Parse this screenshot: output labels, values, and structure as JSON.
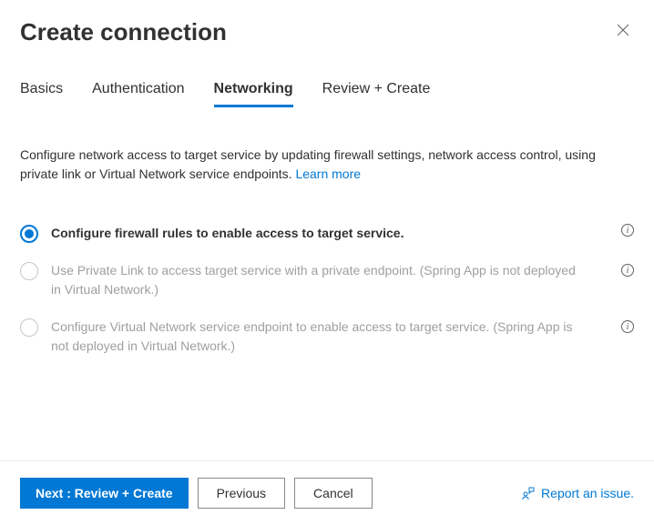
{
  "header": {
    "title": "Create connection"
  },
  "tabs": {
    "basics": "Basics",
    "authentication": "Authentication",
    "networking": "Networking",
    "review": "Review + Create"
  },
  "description": {
    "text": "Configure network access to target service by updating firewall settings, network access control, using private link or Virtual Network service endpoints.",
    "learn_more": "Learn more"
  },
  "options": {
    "opt1": {
      "label": "Configure firewall rules to enable access to target service."
    },
    "opt2": {
      "label": "Use Private Link to access target service with a private endpoint. (Spring App is not deployed in Virtual Network.)"
    },
    "opt3": {
      "label": "Configure Virtual Network service endpoint to enable access to target service. (Spring App is not deployed in Virtual Network.)"
    }
  },
  "footer": {
    "next": "Next : Review + Create",
    "previous": "Previous",
    "cancel": "Cancel",
    "report": "Report an issue."
  },
  "colors": {
    "accent": "#0078d4",
    "text": "#323130",
    "disabled_text": "#a19f9d"
  }
}
